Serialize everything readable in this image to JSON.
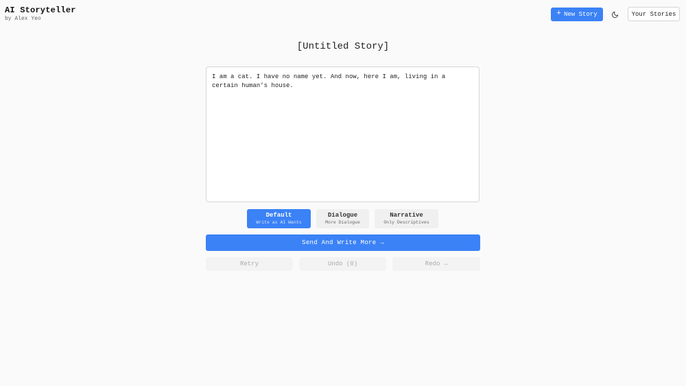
{
  "header": {
    "title": "AI Storyteller",
    "author": "by Alex Yeo",
    "new_story_label": "New Story",
    "new_story_icon": "plus-icon",
    "theme_toggle_icon": "moon-icon",
    "your_stories_label": "Your Stories"
  },
  "story": {
    "title": "[Untitled Story]",
    "text": "I am a cat. I have no name yet. And now, here I am, living in a certain human’s house."
  },
  "modes": [
    {
      "label": "Default",
      "sub": "Write as AI Wants",
      "selected": true
    },
    {
      "label": "Dialogue",
      "sub": "More Dialogue",
      "selected": false
    },
    {
      "label": "Narrative",
      "sub": "Only Descriptives",
      "selected": false
    }
  ],
  "actions": {
    "send_label": "Send And Write More →",
    "retry_label": "Retry",
    "undo_label": "Undo (0)",
    "redo_label": "Redo →"
  },
  "colors": {
    "accent": "#3b82f6",
    "background": "#fafafa",
    "disabled_text": "#aaaaaa"
  }
}
